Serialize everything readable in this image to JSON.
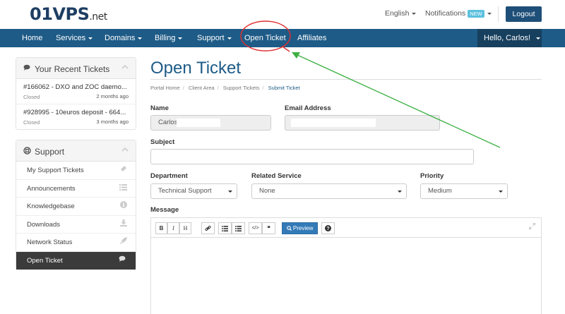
{
  "header": {
    "logo_main": "01VPS",
    "logo_suffix": ".net",
    "language": "English",
    "notifications": "Notifications",
    "new_badge": "NEW",
    "logout": "Logout"
  },
  "nav": {
    "items": [
      "Home",
      "Services",
      "Domains",
      "Billing",
      "Support",
      "Open Ticket",
      "Affiliates"
    ],
    "hello": "Hello, Carlos!"
  },
  "recent": {
    "title": "Your Recent Tickets",
    "tickets": [
      {
        "title": "#166062 - DXO and ZOC daemo...",
        "status": "Closed",
        "ago": "2 months ago"
      },
      {
        "title": "#928995 - 10euros deposit - 664...",
        "status": "Closed",
        "ago": "3 months ago"
      }
    ]
  },
  "support": {
    "title": "Support",
    "items": [
      {
        "label": "My Support Tickets",
        "icon": "ticket-icon"
      },
      {
        "label": "Announcements",
        "icon": "list-icon"
      },
      {
        "label": "Knowledgebase",
        "icon": "info-icon"
      },
      {
        "label": "Downloads",
        "icon": "download-icon"
      },
      {
        "label": "Network Status",
        "icon": "rocket-icon"
      },
      {
        "label": "Open Ticket",
        "icon": "comments-icon"
      }
    ]
  },
  "main": {
    "title": "Open Ticket",
    "breadcrumb": [
      "Portal Home",
      "Client Area",
      "Support Tickets",
      "Submit Ticket"
    ],
    "name_label": "Name",
    "name_value": "Carlos",
    "email_label": "Email Address",
    "subject_label": "Subject",
    "department_label": "Department",
    "department_value": "Technical Support",
    "service_label": "Related Service",
    "service_value": "None",
    "priority_label": "Priority",
    "priority_value": "Medium",
    "message_label": "Message",
    "preview_label": "Preview"
  },
  "colors": {
    "nav_bg": "#1e5b87",
    "accent": "#1e5b87",
    "annotation_circle": "#e03030",
    "annotation_arrow": "#3cb043"
  }
}
